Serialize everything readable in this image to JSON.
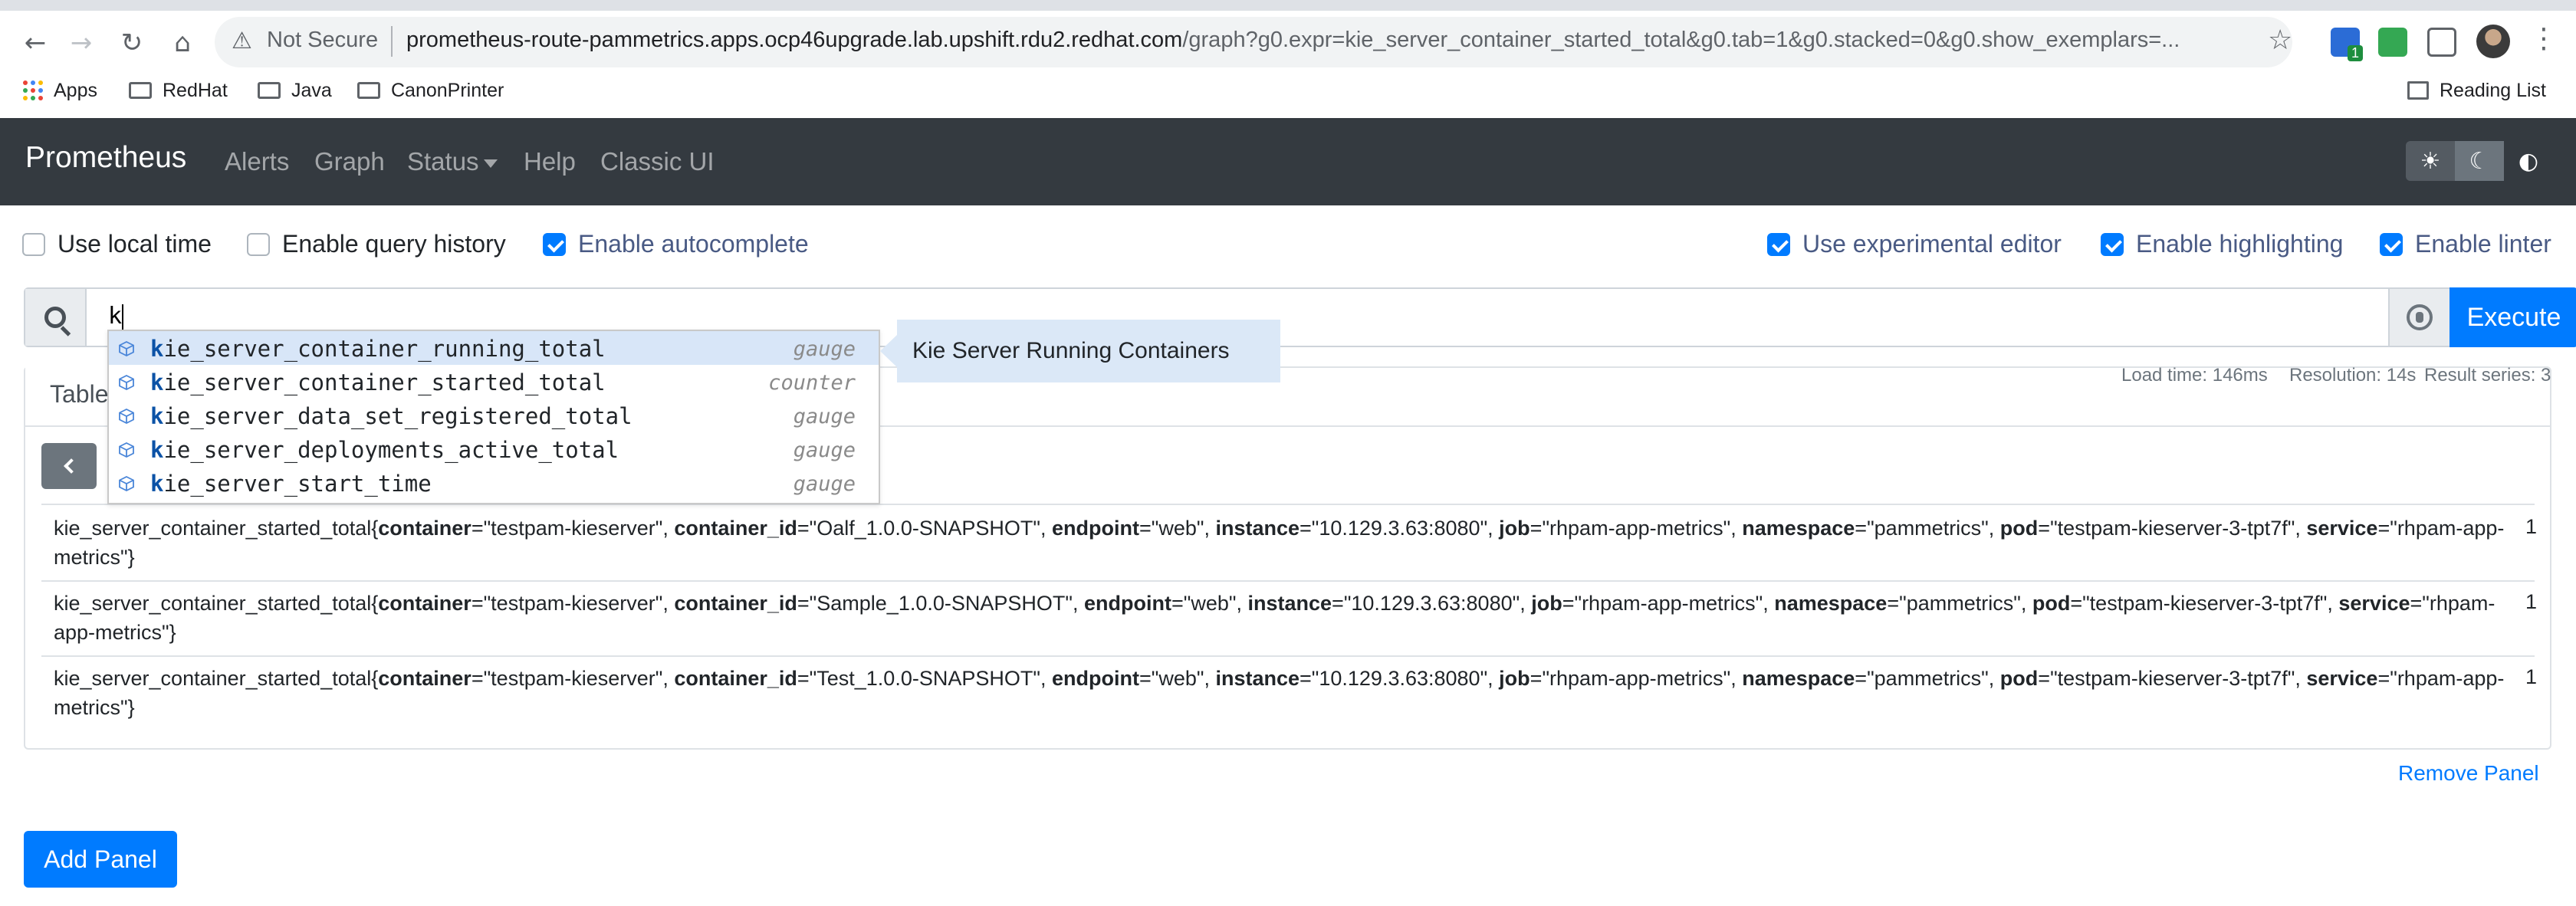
{
  "browser": {
    "security_label": "Not Secure",
    "url_host": "prometheus-route-pammetrics.apps.ocp46upgrade.lab.upshift.rdu2.redhat.com",
    "url_path": "/graph?g0.expr=kie_server_container_started_total&g0.tab=1&g0.stacked=0&g0.show_exemplars=...",
    "bookmarks": [
      "Apps",
      "RedHat",
      "Java",
      "CanonPrinter"
    ],
    "reading_list": "Reading List",
    "extension_badge": "1"
  },
  "navbar": {
    "brand": "Prometheus",
    "links": [
      "Alerts",
      "Graph",
      "Status",
      "Help",
      "Classic UI"
    ]
  },
  "options": {
    "use_local_time": {
      "label": "Use local time",
      "checked": false
    },
    "enable_query_history": {
      "label": "Enable query history",
      "checked": false
    },
    "enable_autocomplete": {
      "label": "Enable autocomplete",
      "checked": true
    },
    "use_experimental_editor": {
      "label": "Use experimental editor",
      "checked": true
    },
    "enable_highlighting": {
      "label": "Enable highlighting",
      "checked": true
    },
    "enable_linter": {
      "label": "Enable linter",
      "checked": true
    }
  },
  "expression": {
    "value": "k",
    "execute_label": "Execute"
  },
  "autocomplete": {
    "items": [
      {
        "match": "k",
        "rest": "ie_server_container_running_total",
        "type": "gauge",
        "selected": true
      },
      {
        "match": "k",
        "rest": "ie_server_container_started_total",
        "type": "counter",
        "selected": false
      },
      {
        "match": "k",
        "rest": "ie_server_data_set_registered_total",
        "type": "gauge",
        "selected": false
      },
      {
        "match": "k",
        "rest": "ie_server_deployments_active_total",
        "type": "gauge",
        "selected": false
      },
      {
        "match": "k",
        "rest": "ie_server_start_time",
        "type": "gauge",
        "selected": false
      }
    ],
    "info": "Kie Server Running Containers"
  },
  "panel": {
    "tab_label": "Table",
    "load_time": "Load time: 146ms",
    "resolution": "Resolution: 14s",
    "result_series": "Result series: 3",
    "rows": [
      {
        "metric": "kie_server_container_started_total",
        "labels": [
          {
            "k": "container",
            "v": "\"testpam-kieserver\""
          },
          {
            "k": "container_id",
            "v": "\"Oalf_1.0.0-SNAPSHOT\""
          },
          {
            "k": "endpoint",
            "v": "\"web\""
          },
          {
            "k": "instance",
            "v": "\"10.129.3.63:8080\""
          },
          {
            "k": "job",
            "v": "\"rhpam-app-metrics\""
          },
          {
            "k": "namespace",
            "v": "\"pammetrics\""
          },
          {
            "k": "pod",
            "v": "\"testpam-kieserver-3-tpt7f\""
          },
          {
            "k": "service",
            "v": "\"rhpam-app-metrics\""
          }
        ],
        "value": "1"
      },
      {
        "metric": "kie_server_container_started_total",
        "labels": [
          {
            "k": "container",
            "v": "\"testpam-kieserver\""
          },
          {
            "k": "container_id",
            "v": "\"Sample_1.0.0-SNAPSHOT\""
          },
          {
            "k": "endpoint",
            "v": "\"web\""
          },
          {
            "k": "instance",
            "v": "\"10.129.3.63:8080\""
          },
          {
            "k": "job",
            "v": "\"rhpam-app-metrics\""
          },
          {
            "k": "namespace",
            "v": "\"pammetrics\""
          },
          {
            "k": "pod",
            "v": "\"testpam-kieserver-3-tpt7f\""
          },
          {
            "k": "service",
            "v": "\"rhpam-app-metrics\""
          }
        ],
        "value": "1"
      },
      {
        "metric": "kie_server_container_started_total",
        "labels": [
          {
            "k": "container",
            "v": "\"testpam-kieserver\""
          },
          {
            "k": "container_id",
            "v": "\"Test_1.0.0-SNAPSHOT\""
          },
          {
            "k": "endpoint",
            "v": "\"web\""
          },
          {
            "k": "instance",
            "v": "\"10.129.3.63:8080\""
          },
          {
            "k": "job",
            "v": "\"rhpam-app-metrics\""
          },
          {
            "k": "namespace",
            "v": "\"pammetrics\""
          },
          {
            "k": "pod",
            "v": "\"testpam-kieserver-3-tpt7f\""
          },
          {
            "k": "service",
            "v": "\"rhpam-app-metrics\""
          }
        ],
        "value": "1"
      }
    ],
    "remove_label": "Remove Panel"
  },
  "add_panel_label": "Add Panel"
}
